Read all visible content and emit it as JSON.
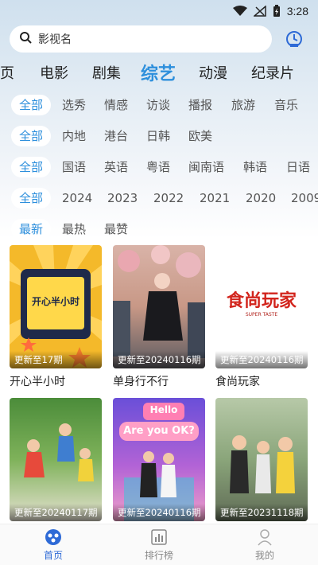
{
  "status": {
    "time": "3:28"
  },
  "search": {
    "placeholder": "影视名"
  },
  "categories": [
    "页",
    "电影",
    "剧集",
    "综艺",
    "动漫",
    "纪录片"
  ],
  "active_category": "综艺",
  "filters": {
    "genre": [
      "全部",
      "选秀",
      "情感",
      "访谈",
      "播报",
      "旅游",
      "音乐"
    ],
    "region": [
      "全部",
      "内地",
      "港台",
      "日韩",
      "欧美"
    ],
    "language": [
      "全部",
      "国语",
      "英语",
      "粤语",
      "闽南语",
      "韩语",
      "日语"
    ],
    "year": [
      "全部",
      "2024",
      "2023",
      "2022",
      "2021",
      "2020",
      "2009"
    ],
    "sort": [
      "最新",
      "最热",
      "最赞"
    ]
  },
  "cards": [
    {
      "title": "开心半小时",
      "update": "更新至17期",
      "poster_text": "开心半小时"
    },
    {
      "title": "单身行不行",
      "update": "更新至20240116期"
    },
    {
      "title": "食尚玩家",
      "update": "更新至20240116期",
      "poster_text": "食尚玩家",
      "poster_subtext": "SUPER TASTE"
    },
    {
      "title": "",
      "update": "更新至20240117期"
    },
    {
      "title": "",
      "update": "更新至20240116期",
      "poster_text": "Hello",
      "poster_text2": "Are you OK?"
    },
    {
      "title": "",
      "update": "更新至20231118期"
    }
  ],
  "nav": [
    {
      "label": "首页",
      "icon": "home-icon",
      "active": true
    },
    {
      "label": "排行榜",
      "icon": "ranking-icon",
      "active": false
    },
    {
      "label": "我的",
      "icon": "profile-icon",
      "active": false
    }
  ],
  "colors": {
    "accent": "#2d8fdc",
    "nav_active": "#2e6ad6"
  }
}
